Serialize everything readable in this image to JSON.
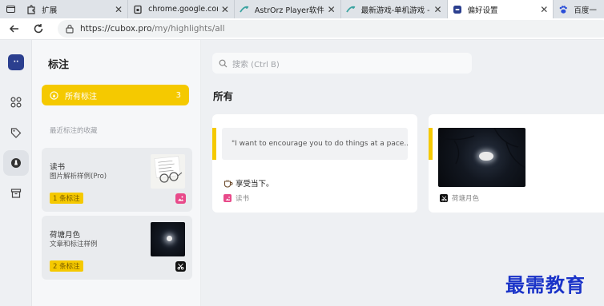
{
  "browser": {
    "tabs": [
      {
        "title": "扩展",
        "icon": "puzzle-icon"
      },
      {
        "title": "chrome.google.com",
        "icon": "page-icon"
      },
      {
        "title": "AstrOrz Player软件下载",
        "icon": "astrorz-icon"
      },
      {
        "title": "最新游戏-单机游戏 - N",
        "icon": "astrorz-icon"
      },
      {
        "title": "偏好设置",
        "icon": "cubox-icon"
      },
      {
        "title": "百度一",
        "icon": "baidu-icon"
      }
    ],
    "active_tab": 4,
    "url_host": "https://cubox.pro",
    "url_path": "/my/highlights/all"
  },
  "sidebar": {
    "title": "标注",
    "all_label": "所有标注",
    "all_count": "3",
    "recent_label": "最近标注的收藏",
    "cards": [
      {
        "title": "读书",
        "subtitle": "图片解析样例(Pro)",
        "badge": "1 条标注",
        "thumb": "glasses-note-image",
        "source_icon": "image-icon"
      },
      {
        "title": "荷塘月色",
        "subtitle": "文章和标注样例",
        "badge": "2 条标注",
        "thumb": "moon-night-image",
        "source_icon": "scissors-icon"
      }
    ]
  },
  "main": {
    "search_placeholder": "搜索 (Ctrl B)",
    "section_title": "所有",
    "highlights": [
      {
        "quote": "\"I want to encourage you to do things at a pace...",
        "note": "享受当下。",
        "source": "读书",
        "source_icon": "image-icon"
      },
      {
        "image": "moon-night-image",
        "source": "荷塘月色",
        "source_icon": "scissors-icon"
      }
    ]
  },
  "watermark": "最需教育",
  "colors": {
    "accent": "#f5c900",
    "image_source": "#e84a8a",
    "logo": "#2b3f8f"
  }
}
